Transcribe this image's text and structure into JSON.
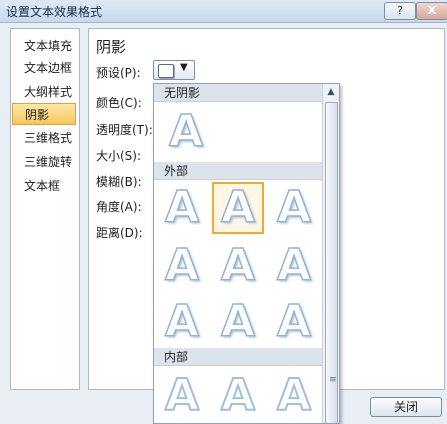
{
  "window": {
    "title": "设置文本效果格式",
    "help_label": "?",
    "close_label": "X"
  },
  "nav": {
    "items": [
      {
        "label": "文本填充"
      },
      {
        "label": "文本边框"
      },
      {
        "label": "大纲样式"
      },
      {
        "label": "阴影",
        "selected": true
      },
      {
        "label": "三维格式"
      },
      {
        "label": "三维旋转"
      },
      {
        "label": "文本框"
      }
    ]
  },
  "panel": {
    "title": "阴影",
    "preset_label": "预设(P):",
    "color_label": "颜色(C):",
    "transparency_label": "透明度(T):",
    "size_label": "大小(S):",
    "blur_label": "模糊(B):",
    "angle_label": "角度(A):",
    "distance_label": "距离(D):"
  },
  "gallery": {
    "sections": [
      {
        "name": "无阴影",
        "tiles": 1
      },
      {
        "name": "外部",
        "tiles": 9,
        "selected_index": 1
      },
      {
        "name": "内部",
        "tiles": 3
      }
    ],
    "tile_glyph": "A"
  },
  "footer": {
    "close_button": "关闭"
  },
  "colors": {
    "selection": "#f8c75b",
    "tile_stroke": "#8fb3d8"
  }
}
